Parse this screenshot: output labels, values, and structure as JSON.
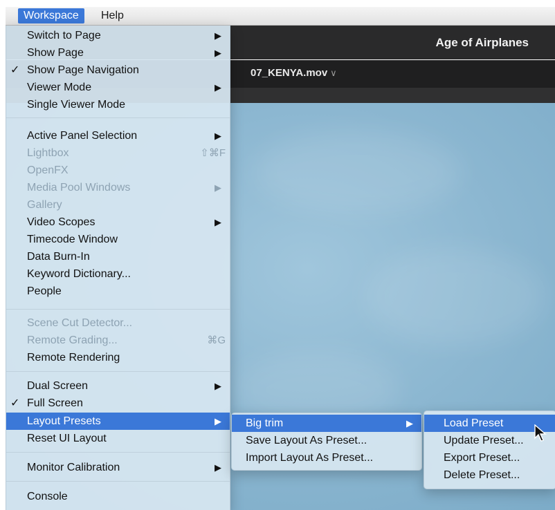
{
  "menubar": {
    "items": [
      {
        "label": "Workspace"
      },
      {
        "label": "Help"
      }
    ]
  },
  "titlebar": {
    "project_title": "Age of Airplanes"
  },
  "clipbar": {
    "clip_name": "07_KENYA.mov",
    "caret": "∨"
  },
  "icons": {
    "check": "✓",
    "submenu_arrow": "▶"
  },
  "workspace_menu": {
    "items": [
      {
        "label": "Switch to Page"
      },
      {
        "label": "Show Page"
      },
      {
        "label": "Show Page Navigation"
      },
      {
        "label": "Viewer Mode"
      },
      {
        "label": "Single Viewer Mode"
      },
      {
        "label": "Active Panel Selection"
      },
      {
        "label": "Lightbox",
        "shortcut": "⇧⌘F"
      },
      {
        "label": "OpenFX"
      },
      {
        "label": "Media Pool Windows"
      },
      {
        "label": "Gallery"
      },
      {
        "label": "Video Scopes"
      },
      {
        "label": "Timecode Window"
      },
      {
        "label": "Data Burn-In"
      },
      {
        "label": "Keyword Dictionary..."
      },
      {
        "label": "People"
      },
      {
        "label": "Scene Cut Detector..."
      },
      {
        "label": "Remote Grading...",
        "shortcut": "⌘G"
      },
      {
        "label": "Remote Rendering"
      },
      {
        "label": "Dual Screen"
      },
      {
        "label": "Full Screen"
      },
      {
        "label": "Layout Presets"
      },
      {
        "label": "Reset UI Layout"
      },
      {
        "label": "Monitor Calibration"
      },
      {
        "label": "Console"
      }
    ]
  },
  "layout_presets_menu": {
    "items": [
      {
        "label": "Big trim"
      },
      {
        "label": "Save Layout As Preset..."
      },
      {
        "label": "Import Layout As Preset..."
      }
    ]
  },
  "preset_menu": {
    "items": [
      {
        "label": "Load Preset"
      },
      {
        "label": "Update Preset..."
      },
      {
        "label": "Export Preset..."
      },
      {
        "label": "Delete Preset..."
      }
    ]
  }
}
